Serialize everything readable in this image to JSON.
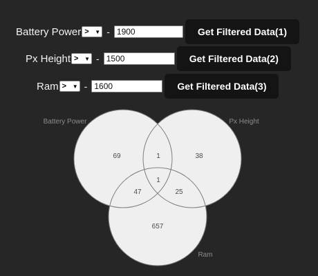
{
  "filters": [
    {
      "label": "Battery Power",
      "operator": ">",
      "value": "1900",
      "button": "Get Filtered Data(1)"
    },
    {
      "label": "Px Height",
      "operator": ">",
      "value": "1500",
      "button": "Get Filtered Data(2)"
    },
    {
      "label": "Ram",
      "operator": ">",
      "value": "1600",
      "button": "Get Filtered Data(3)"
    }
  ],
  "separator": "-",
  "venn": {
    "sets": [
      {
        "name": "Battery Power",
        "only": "69"
      },
      {
        "name": "Px Height",
        "only": "38"
      },
      {
        "name": "Ram",
        "only": "657"
      }
    ],
    "intersections": {
      "battery_px": "1",
      "battery_ram": "47",
      "px_ram": "25",
      "all": "1"
    },
    "colors": {
      "fill": "#efefef",
      "stroke": "#7c7c7c",
      "label": "#8c8c8c",
      "count": "#4a4a4a"
    }
  },
  "icons": {
    "dropdown": "chevron-down-icon"
  }
}
